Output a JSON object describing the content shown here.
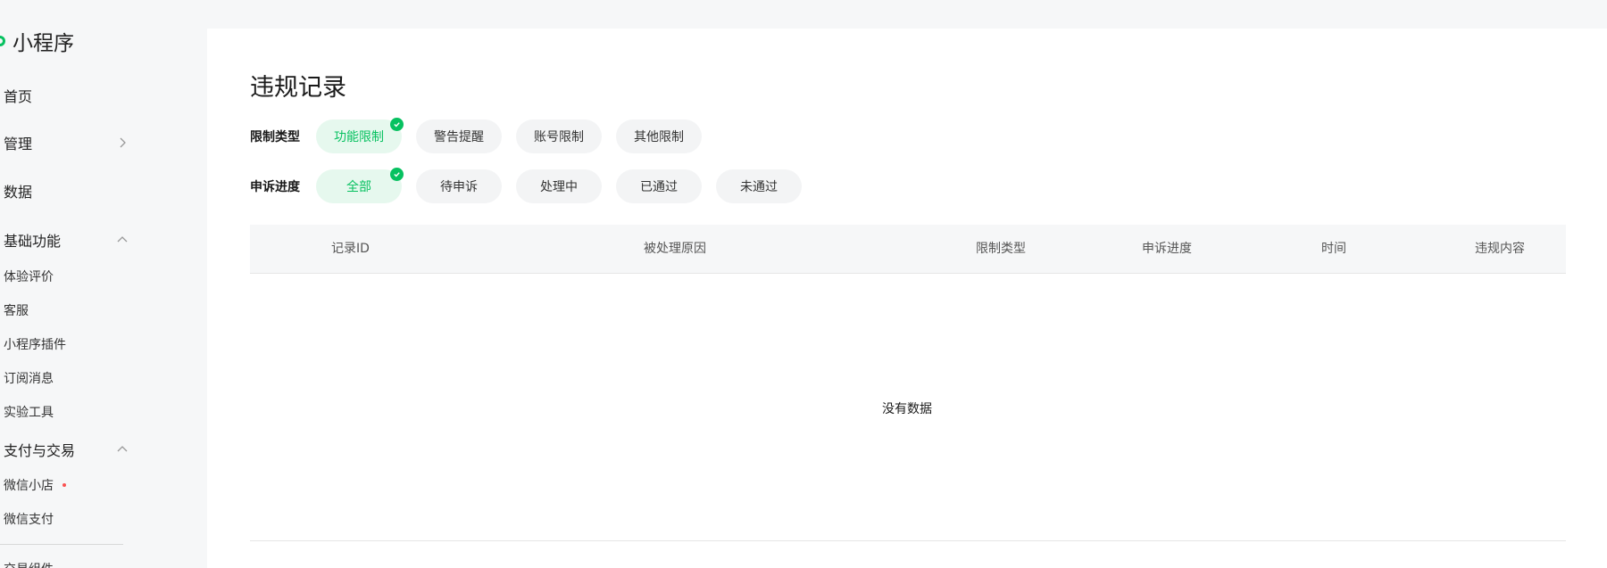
{
  "sidebar": {
    "logo_text": "小程序",
    "items": {
      "home": "首页",
      "manage": "管理",
      "data": "数据",
      "basic_features": "基础功能",
      "experience_rating": "体验评价",
      "customer_service": "客服",
      "plugin": "小程序插件",
      "subscribe_message": "订阅消息",
      "lab_tools": "实验工具",
      "payment_trade": "支付与交易",
      "wechat_store": "微信小店",
      "wechat_pay": "微信支付",
      "trade_component": "交易组件"
    }
  },
  "page": {
    "title": "违规记录"
  },
  "filters": {
    "restriction_type": {
      "label": "限制类型",
      "options": [
        "功能限制",
        "警告提醒",
        "账号限制",
        "其他限制"
      ],
      "selected": "功能限制"
    },
    "appeal_progress": {
      "label": "申诉进度",
      "options": [
        "全部",
        "待申诉",
        "处理中",
        "已通过",
        "未通过"
      ],
      "selected": "全部"
    }
  },
  "table": {
    "columns": [
      "记录ID",
      "被处理原因",
      "限制类型",
      "申诉进度",
      "时间",
      "违规内容"
    ],
    "empty_text": "没有数据"
  },
  "colors": {
    "accent": "#07c160",
    "chip_selected_bg": "#e6f8ee",
    "notification_dot": "#fa5151"
  }
}
